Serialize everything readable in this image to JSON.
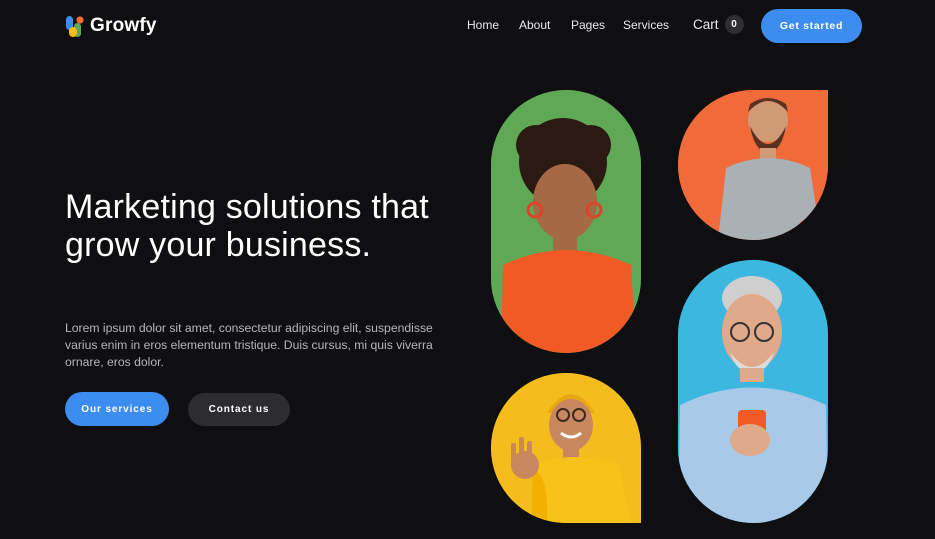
{
  "brand": {
    "name": "Growfy",
    "colors": {
      "blue": "#3d8cf0",
      "orange": "#f06a3a",
      "green": "#5fa855",
      "yellow": "#f4bd1c",
      "cyan": "#3cb7e0"
    }
  },
  "nav": {
    "items": [
      "Home",
      "About",
      "Pages",
      "Services"
    ]
  },
  "cart": {
    "label": "Cart",
    "count": "0"
  },
  "header_cta": "Get started",
  "hero": {
    "title": "Marketing solutions that grow your business.",
    "description": "Lorem ipsum dolor sit amet, consectetur adipiscing elit, suspendisse varius enim in eros elementum tristique. Duis cursus, mi quis viverra ornare, eros dolor.",
    "primary_button": "Our services",
    "secondary_button": "Contact us"
  },
  "images": [
    {
      "name": "woman-orange-sweater-photo",
      "icon": "person-photo"
    },
    {
      "name": "bearded-man-grey-tshirt-photo",
      "icon": "person-photo"
    },
    {
      "name": "man-yellow-beanie-ok-sign-photo",
      "icon": "person-photo"
    },
    {
      "name": "senior-man-phone-photo",
      "icon": "person-photo"
    }
  ]
}
